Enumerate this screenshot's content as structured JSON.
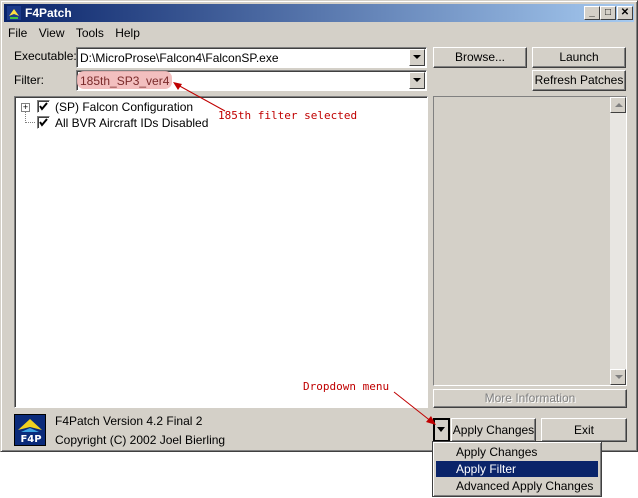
{
  "window": {
    "title": "F4Patch",
    "icon": "f4patch-app-icon"
  },
  "titlebar_buttons": {
    "minimize": "_",
    "maximize": "□",
    "close": "✕"
  },
  "menubar": {
    "items": [
      "File",
      "View",
      "Tools",
      "Help"
    ]
  },
  "executable": {
    "label": "Executable:",
    "value": "D:\\MicroProse\\Falcon4\\FalconSP.exe"
  },
  "filter": {
    "label": "Filter:",
    "value": "185th_SP3_ver4"
  },
  "buttons": {
    "browse": "Browse...",
    "launch": "Launch",
    "refresh": "Refresh Patches",
    "more_info": "More Information",
    "apply": "Apply Changes",
    "exit": "Exit"
  },
  "tree": [
    {
      "label": "(SP) Falcon Configuration",
      "checked": true,
      "expandable": true
    },
    {
      "label": "All BVR Aircraft IDs Disabled",
      "checked": true,
      "expandable": false
    }
  ],
  "footer": {
    "logo_text": "F4P",
    "version": "F4Patch Version  4.2 Final 2",
    "copyright": "Copyright (C) 2002 Joel Bierling"
  },
  "annotations": {
    "filter_note": "185th filter selected",
    "dropdown_note": "Dropdown menu"
  },
  "apply_menu": {
    "items": [
      "Apply Changes",
      "Apply Filter",
      "Advanced Apply Changes"
    ],
    "selected": "Apply Filter"
  },
  "colors": {
    "titlebar": "#0a246a",
    "annotation": "#c00000",
    "highlight": "#0a246a",
    "filter_highlight": "#f2b8b8"
  }
}
